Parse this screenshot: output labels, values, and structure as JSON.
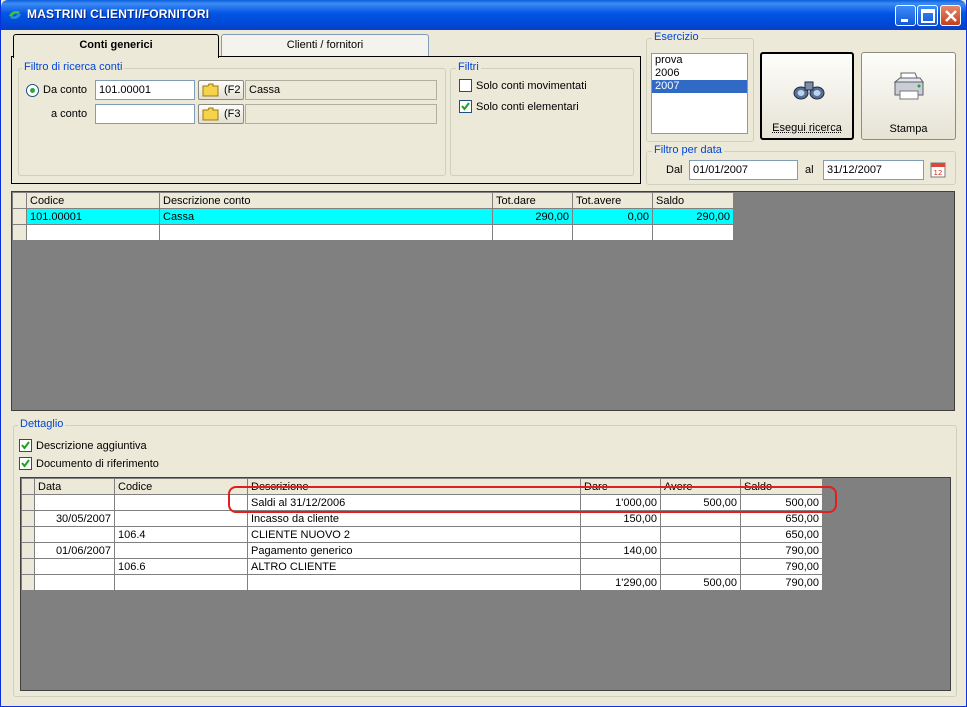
{
  "window": {
    "title": "MASTRINI CLIENTI/FORNITORI"
  },
  "tabs": [
    {
      "label": "Conti generici",
      "active": true
    },
    {
      "label": "Clienti / fornitori",
      "active": false
    }
  ],
  "filtro_conti": {
    "label": "Filtro di ricerca conti",
    "da_conto_label": "Da conto",
    "da_conto_value": "101.00001",
    "da_conto_key": "(F2",
    "da_conto_desc": "Cassa",
    "a_conto_label": "a conto",
    "a_conto_value": "",
    "a_conto_key": "(F3",
    "a_conto_desc": ""
  },
  "filtri": {
    "label": "Filtri",
    "solo_movimentati_label": "Solo conti movimentati",
    "solo_movimentati_checked": false,
    "solo_elementari_label": "Solo conti elementari",
    "solo_elementari_checked": true
  },
  "esercizio": {
    "label": "Esercizio",
    "items": [
      "prova",
      "2006",
      "2007"
    ],
    "selected": "2007"
  },
  "buttons": {
    "esegui": "Esegui ricerca",
    "stampa": "Stampa"
  },
  "filtro_data": {
    "label": "Filtro per data",
    "dal_label": "Dal",
    "dal_value": "01/01/2007",
    "al_label": "al",
    "al_value": "31/12/2007"
  },
  "conti_table": {
    "headers": [
      "Codice",
      "Descrizione conto",
      "Tot.dare",
      "Tot.avere",
      "Saldo"
    ],
    "rows": [
      [
        "101.00001",
        "Cassa",
        "290,00",
        "0,00",
        "290,00"
      ],
      [
        "",
        "",
        "",
        "",
        ""
      ]
    ]
  },
  "dettaglio": {
    "label": "Dettaglio",
    "descr_aggiuntiva_label": "Descrizione aggiuntiva",
    "descr_aggiuntiva_checked": true,
    "doc_riferimento_label": "Documento di riferimento",
    "doc_riferimento_checked": true,
    "headers": [
      "Data",
      "Codice",
      "Descrizione",
      "Dare",
      "Avere",
      "Saldo"
    ],
    "rows": [
      [
        "",
        "",
        "Saldi al 31/12/2006",
        "1'000,00",
        "500,00",
        "500,00"
      ],
      [
        "30/05/2007",
        "",
        "Incasso da cliente",
        "150,00",
        "",
        "650,00"
      ],
      [
        "",
        "106.4",
        "CLIENTE NUOVO 2",
        "",
        "",
        "650,00"
      ],
      [
        "01/06/2007",
        "",
        "Pagamento generico",
        "140,00",
        "",
        "790,00"
      ],
      [
        "",
        "106.6",
        "ALTRO CLIENTE",
        "",
        "",
        "790,00"
      ],
      [
        "",
        "",
        "",
        "1'290,00",
        "500,00",
        "790,00"
      ]
    ]
  },
  "colors": {
    "highlight_row": "#00ffff",
    "group_label": "#0046d5",
    "annotation": "#e02020"
  }
}
